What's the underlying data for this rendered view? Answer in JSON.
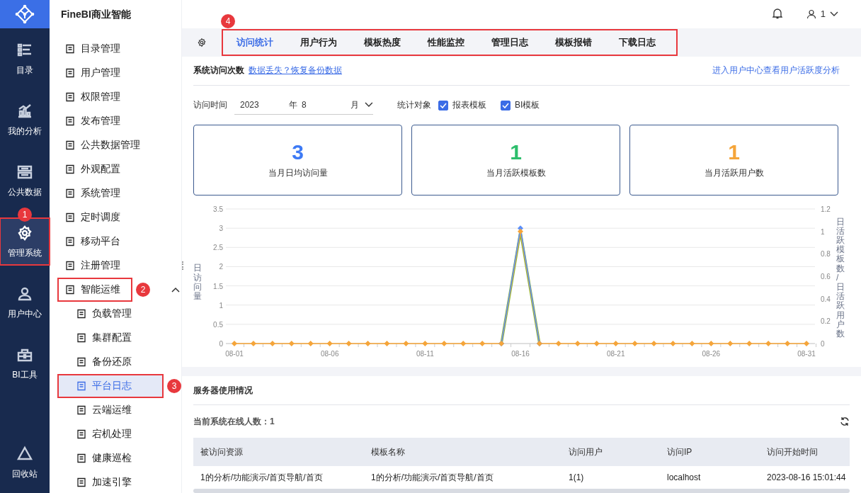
{
  "app": {
    "title": "FineBI商业智能"
  },
  "header": {
    "user": "1"
  },
  "nav": [
    {
      "label": "目录",
      "selected": false
    },
    {
      "label": "我的分析",
      "selected": false
    },
    {
      "label": "公共数据",
      "selected": false
    },
    {
      "label": "管理系统",
      "selected": true,
      "callout": "1"
    },
    {
      "label": "用户中心",
      "selected": false
    },
    {
      "label": "BI工具",
      "selected": false
    },
    {
      "label": "回收站",
      "selected": false
    }
  ],
  "menu": [
    {
      "label": "目录管理",
      "selected": false
    },
    {
      "label": "用户管理",
      "selected": false
    },
    {
      "label": "权限管理",
      "selected": false
    },
    {
      "label": "发布管理",
      "selected": false
    },
    {
      "label": "公共数据管理",
      "selected": false
    },
    {
      "label": "外观配置",
      "selected": false
    },
    {
      "label": "系统管理",
      "selected": false
    },
    {
      "label": "定时调度",
      "selected": false
    },
    {
      "label": "移动平台",
      "selected": false
    },
    {
      "label": "注册管理",
      "selected": false
    },
    {
      "label": "智能运维",
      "selected": false,
      "expanded": true,
      "callout": "2",
      "children": [
        {
          "label": "负载管理",
          "selected": false
        },
        {
          "label": "集群配置",
          "selected": false
        },
        {
          "label": "备份还原",
          "selected": false
        },
        {
          "label": "平台日志",
          "selected": true,
          "callout": "3"
        },
        {
          "label": "云端运维",
          "selected": false
        },
        {
          "label": "宕机处理",
          "selected": false
        },
        {
          "label": "健康巡检",
          "selected": false
        },
        {
          "label": "加速引擎",
          "selected": false
        }
      ]
    }
  ],
  "tabs": {
    "callout": "4",
    "items": [
      {
        "label": "访问统计",
        "selected": true
      },
      {
        "label": "用户行为",
        "selected": false
      },
      {
        "label": "模板热度",
        "selected": false
      },
      {
        "label": "性能监控",
        "selected": false
      },
      {
        "label": "管理日志",
        "selected": false
      },
      {
        "label": "模板报错",
        "selected": false
      },
      {
        "label": "下载日志",
        "selected": false
      }
    ]
  },
  "visits": {
    "title": "系统访问次数",
    "link": "数据丢失？恢复备份数据",
    "right_link": "进入用户中心查看用户活跃度分析",
    "filters": {
      "label": "访问时间",
      "year": "2023",
      "year_unit": "年",
      "month": "8",
      "month_unit": "月",
      "target_label": "统计对象",
      "options": [
        {
          "label": "报表模板",
          "checked": true
        },
        {
          "label": "BI模板",
          "checked": true
        }
      ]
    },
    "stats": [
      {
        "value": "3",
        "label": "当月日均访问量",
        "color": "#3d7af5"
      },
      {
        "value": "1",
        "label": "当月活跃模板数",
        "color": "#2dbe6c"
      },
      {
        "value": "1",
        "label": "当月活跃用户数",
        "color": "#f5a53a"
      }
    ],
    "chart_data": {
      "type": "line",
      "ylabel": "日访问量",
      "y2label": "日活跃模板数 / 日活跃用户数",
      "categories": [
        "08-01",
        null,
        null,
        null,
        null,
        "08-06",
        null,
        null,
        null,
        null,
        "08-11",
        null,
        null,
        null,
        null,
        "08-16",
        null,
        null,
        null,
        null,
        "08-21",
        null,
        null,
        null,
        null,
        "08-26",
        null,
        null,
        null,
        null,
        "08-31"
      ],
      "grid": true,
      "ylim": [
        0,
        3.5
      ],
      "yticks": [
        0,
        0.5,
        1,
        1.5,
        2,
        2.5,
        3,
        3.5
      ],
      "y2lim": [
        0,
        1.2
      ],
      "y2ticks": [
        0,
        0.2,
        0.4,
        0.6,
        0.8,
        1,
        1.2
      ],
      "series": [
        {
          "color": "#5b8ff9",
          "marker": "diamond",
          "values": [
            null,
            null,
            null,
            null,
            null,
            null,
            null,
            null,
            null,
            null,
            null,
            null,
            null,
            null,
            0,
            3,
            0,
            null,
            null,
            null,
            null,
            null,
            null,
            null,
            null,
            null,
            null,
            null,
            null,
            null,
            null
          ]
        },
        {
          "color": "#f5a53a",
          "axis": "y2",
          "marker": "diamond",
          "values": [
            0,
            0,
            0,
            0,
            0,
            0,
            0,
            0,
            0,
            0,
            0,
            0,
            0,
            0,
            0,
            1,
            0,
            0,
            0,
            0,
            0,
            0,
            0,
            0,
            0,
            0,
            0,
            0,
            0,
            0,
            0
          ]
        },
        {
          "color": "#8fb83a",
          "axis": "y2",
          "values": [
            null,
            null,
            null,
            null,
            null,
            null,
            null,
            null,
            null,
            null,
            null,
            null,
            null,
            null,
            0,
            1,
            0,
            null,
            null,
            null,
            null,
            null,
            null,
            null,
            null,
            null,
            null,
            null,
            null,
            null,
            null
          ]
        }
      ]
    }
  },
  "server": {
    "title": "服务器使用情况",
    "online_label": "当前系统在线人数：",
    "online_count": "1",
    "table": {
      "columns": [
        "被访问资源",
        "模板名称",
        "访问用户",
        "访问IP",
        "访问开始时间"
      ],
      "rows": [
        [
          "1的分析/功能演示/首页导航/首页",
          "1的分析/功能演示/首页导航/首页",
          "1(1)",
          "localhost",
          "2023-08-16 15:01:44"
        ]
      ]
    }
  }
}
